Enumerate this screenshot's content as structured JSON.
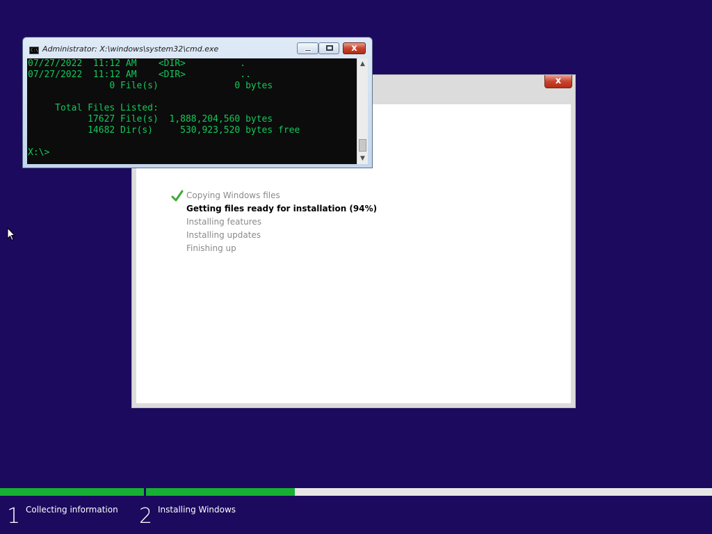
{
  "cmd": {
    "title": "Administrator: X:\\windows\\system32\\cmd.exe",
    "icon": "console-icon",
    "output": "07/27/2022  11:12 AM    <DIR>          .\n07/27/2022  11:12 AM    <DIR>          ..\n               0 File(s)              0 bytes\n\n     Total Files Listed:\n           17627 File(s)  1,888,204,560 bytes\n           14682 Dir(s)     530,923,520 bytes free\n\nX:\\>",
    "text_color": "#13c95a",
    "background": "#0c0c0c"
  },
  "setup": {
    "close_label": "x",
    "steps": [
      {
        "label": "Copying Windows files",
        "state": "done"
      },
      {
        "label": "Getting files ready for installation (94%)",
        "state": "current"
      },
      {
        "label": "Installing features",
        "state": "pending"
      },
      {
        "label": "Installing updates",
        "state": "pending"
      },
      {
        "label": "Finishing up",
        "state": "pending"
      }
    ]
  },
  "progress": {
    "phases": [
      {
        "number": "1",
        "label": "Collecting information",
        "fill_fraction": 1.0
      },
      {
        "number": "2",
        "label": "Installing Windows",
        "fill_fraction": 0.263
      }
    ],
    "fill_color": "#17b033"
  },
  "desktop": {
    "background": "#1c0a5e"
  }
}
